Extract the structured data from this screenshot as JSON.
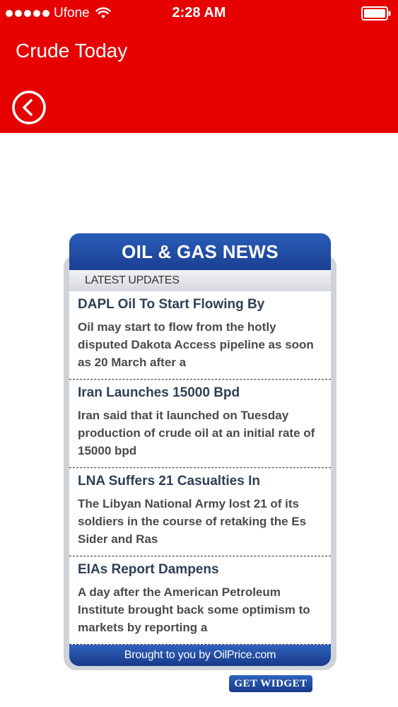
{
  "status_bar": {
    "carrier": "Ufone",
    "time": "2:28 AM"
  },
  "header": {
    "title": "Crude Today",
    "background_color": "#e60000",
    "back_icon": "back-circle-icon"
  },
  "widget": {
    "title": "OIL & GAS NEWS",
    "subtitle": "LATEST UPDATES",
    "footer": "Brought to you by OilPrice.com",
    "get_widget_label": "GET WIDGET",
    "accent_color": "#1f4aa3",
    "items": [
      {
        "title": "DAPL Oil To Start Flowing By",
        "summary": "Oil may start to flow from the hotly disputed Dakota Access pipeline as soon as 20 March after a"
      },
      {
        "title": "Iran Launches 15000 Bpd",
        "summary": "Iran said that it launched on Tuesday production of crude oil at an initial rate of 15000 bpd"
      },
      {
        "title": "LNA Suffers 21 Casualties In",
        "summary": "The Libyan National Army lost 21 of its soldiers in the course of retaking the Es Sider and Ras"
      },
      {
        "title": "EIAs Report Dampens",
        "summary": "A day after the American Petroleum Institute brought back some optimism to markets by reporting a"
      }
    ]
  }
}
